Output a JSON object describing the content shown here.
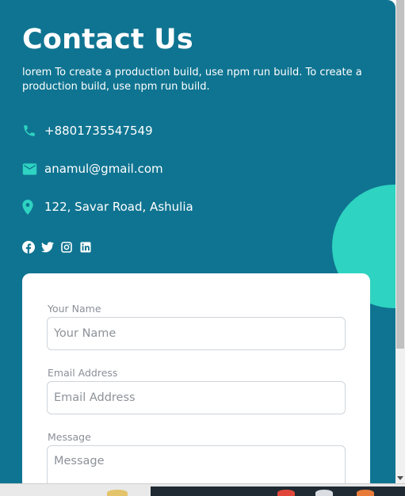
{
  "contact": {
    "title": "Contact Us",
    "description": "lorem To create a production build, use npm run build. To create a production build, use npm run build.",
    "phone": "+8801735547549",
    "email": "anamul@gmail.com",
    "address": "122, Savar Road, Ashulia"
  },
  "social": {
    "icons": [
      "facebook-icon",
      "twitter-icon",
      "instagram-icon",
      "linkedin-icon"
    ]
  },
  "form": {
    "name_label": "Your Name",
    "name_placeholder": "Your Name",
    "email_label": "Email Address",
    "email_placeholder": "Email Address",
    "message_label": "Message",
    "message_placeholder": "Message"
  },
  "theme": {
    "panel_bg": "#0f7491",
    "accent": "#2ed3c1",
    "card_bg": "#ffffff"
  }
}
